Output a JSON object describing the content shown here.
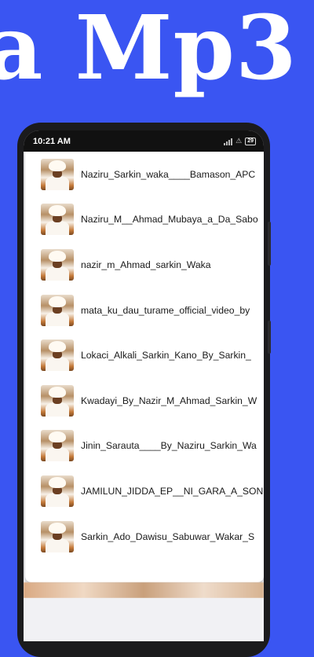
{
  "banner": {
    "text": "a Mp3"
  },
  "status_bar": {
    "time": "10:21 AM",
    "battery": "29"
  },
  "songs": [
    {
      "title": "Naziru_Sarkin_waka____Bamason_APC"
    },
    {
      "title": "Naziru_M__Ahmad_Mubaya_a_Da_Sabo"
    },
    {
      "title": "nazir_m_Ahmad_sarkin_Waka"
    },
    {
      "title": "mata_ku_dau_turame_official_video_by"
    },
    {
      "title": "Lokaci_Alkali_Sarkin_Kano_By_Sarkin_"
    },
    {
      "title": "Kwadayi_By_Nazir_M_Ahmad_Sarkin_W"
    },
    {
      "title": "Jinin_Sarauta____By_Naziru_Sarkin_Wa"
    },
    {
      "title": "JAMILUN_JIDDA_EP__NI_GARA_A_SON"
    },
    {
      "title": "Sarkin_Ado_Dawisu_Sabuwar_Wakar_S"
    }
  ],
  "colors": {
    "background": "#3a55f2",
    "card": "#ffffff"
  }
}
